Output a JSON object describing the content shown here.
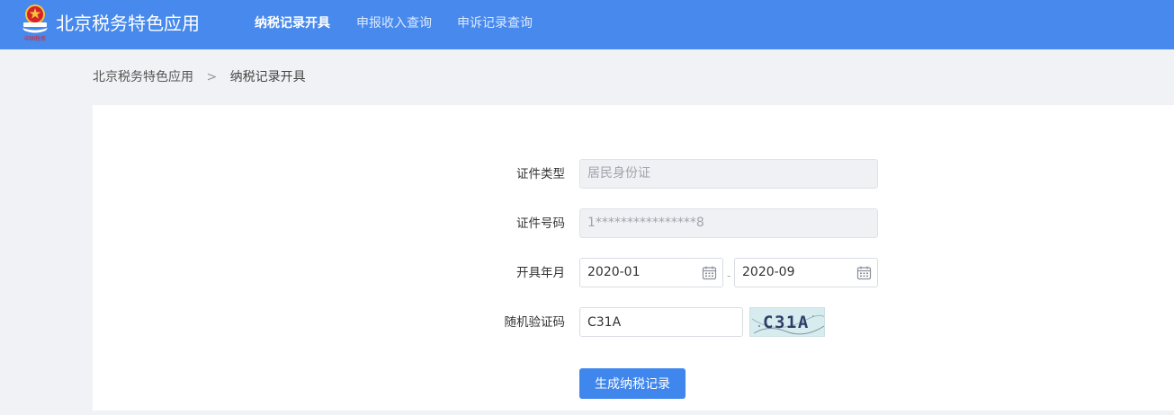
{
  "header": {
    "app_title": "北京税务特色应用",
    "nav": [
      {
        "label": "纳税记录开具",
        "active": true
      },
      {
        "label": "申报收入查询",
        "active": false
      },
      {
        "label": "申诉记录查询",
        "active": false
      }
    ],
    "logo_icon": "tax-emblem-icon",
    "bg_color": "#4789ec"
  },
  "breadcrumb": {
    "root": "北京税务特色应用",
    "separator": ">",
    "current": "纳税记录开具"
  },
  "form": {
    "id_type_label": "证件类型",
    "id_type_value": "居民身份证",
    "id_number_label": "证件号码",
    "id_number_value": "1****************8",
    "period_label": "开具年月",
    "period_start": "2020-01",
    "period_end": "2020-09",
    "period_separator": "-",
    "captcha_label": "随机验证码",
    "captcha_input_value": "C31A",
    "captcha_image_text": "C31A",
    "submit_label": "生成纳税记录",
    "calendar_icon": "calendar-icon",
    "accent_color": "#3f86ed"
  }
}
